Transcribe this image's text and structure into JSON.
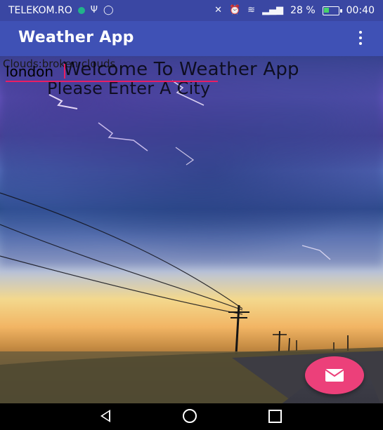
{
  "status_bar": {
    "carrier": "TELEKOM.RO",
    "battery_text": "28 %",
    "time": "00:40",
    "icons": [
      "carrier-dot-icon",
      "usb-icon",
      "whatsapp-icon",
      "mute-icon",
      "alarm-icon",
      "wifi-icon",
      "signal-icon",
      "battery-icon"
    ]
  },
  "app_bar": {
    "title": "Weather App",
    "menu_icon": "overflow-menu-icon"
  },
  "content": {
    "weather_description": "Clouds:broken clouds",
    "city_input_value": "london",
    "welcome_line1": "Welcome To Weather App",
    "welcome_line2": "Please Enter A City"
  },
  "fab": {
    "icon": "mail-icon",
    "color": "#ec407a"
  },
  "nav_bar": {
    "icons": [
      "back-icon",
      "home-icon",
      "recent-apps-icon"
    ]
  },
  "colors": {
    "status_bar": "#3a47a3",
    "app_bar": "#3f51b5",
    "accent": "#e91e63"
  }
}
